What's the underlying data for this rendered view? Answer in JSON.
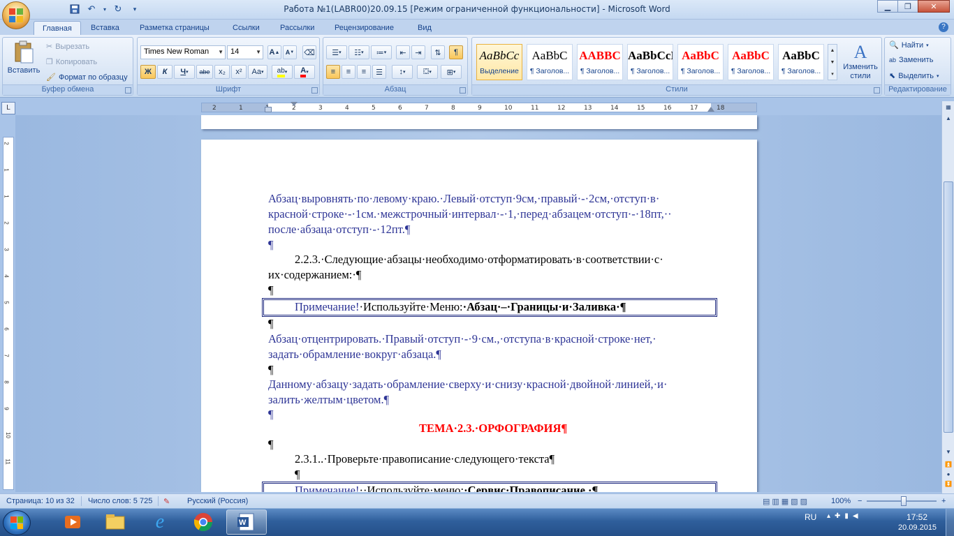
{
  "title": "Работа №1(LABR00)20.09.15 [Режим ограниченной функциональности] - Microsoft Word",
  "tabs": [
    "Главная",
    "Вставка",
    "Разметка страницы",
    "Ссылки",
    "Рассылки",
    "Рецензирование",
    "Вид"
  ],
  "ribbon": {
    "clipboard": {
      "paste": "Вставить",
      "cut": "Вырезать",
      "copy": "Копировать",
      "format_painter": "Формат по образцу",
      "label": "Буфер обмена"
    },
    "font": {
      "font_name": "Times New Roman",
      "font_size": "14",
      "label": "Шрифт",
      "bold": "Ж",
      "italic": "К",
      "underline": "Ч",
      "strike": "abe",
      "sub": "x₂",
      "sup": "x²",
      "case": "Aa",
      "grow": "A",
      "shrink": "A"
    },
    "paragraph": {
      "label": "Абзац"
    },
    "styles": {
      "label": "Стили",
      "items": [
        {
          "preview": "AaBbCc",
          "name": "Выделение",
          "color": "#000000"
        },
        {
          "preview": "AaBbC",
          "name": "¶ Заголов...",
          "color": "#000000"
        },
        {
          "preview": "AABBC",
          "name": "¶ Заголов...",
          "color": "#ff0000"
        },
        {
          "preview": "AaBbCcI",
          "name": "¶ Заголов...",
          "color": "#000000"
        },
        {
          "preview": "AaBbC",
          "name": "¶ Заголов...",
          "color": "#ff0000"
        },
        {
          "preview": "AaBbC",
          "name": "¶ Заголов...",
          "color": "#ff0000"
        },
        {
          "preview": "AaBbC",
          "name": "¶ Заголов...",
          "color": "#000000"
        }
      ],
      "change": "Изменить стили"
    },
    "editing": {
      "find": "Найти",
      "replace": "Заменить",
      "select": "Выделить",
      "label": "Редактирование"
    }
  },
  "ruler": {
    "ticks": [
      "2",
      "1",
      "1",
      "2",
      "3",
      "4",
      "5",
      "6",
      "7",
      "8",
      "9",
      "10",
      "11",
      "12",
      "13",
      "14",
      "15",
      "16",
      "17",
      "18"
    ]
  },
  "vruler": {
    "ticks": [
      "2",
      "1",
      "1",
      "2",
      "3",
      "4",
      "5",
      "6",
      "7",
      "8",
      "9",
      "10",
      "11"
    ]
  },
  "doc": {
    "p1": [
      "Абзац·выровнять·по·левому·краю.·Левый·отступ·9см,·правый·-·2см,·отступ·в·",
      "красной·строке·-·1см.·межстрочный·интервал·-·1,·перед·абзацем·отступ·-·18пт,··",
      "после·абзаца·отступ·-·12пт.¶"
    ],
    "pmark": "¶",
    "p2": [
      "2.2.3.·Следующие·абзацы·необходимо·отформатировать·в·соответствии·с·",
      "их·содержанием:·¶"
    ],
    "note1_a": "Примечание!",
    "note1_b": "·Используйте·Меню:",
    "note1_c": "·Абзац·–·Границы·и·Заливка·¶",
    "p3": [
      "Абзац·отцентрировать.·Правый·отступ·-·9·см.,·отступа·в·красной·строке·нет,·",
      "задать·обрамление·вокруг·абзаца.¶"
    ],
    "p4": [
      "Данному·абзацу·задать·обрамление·сверху·и·снизу·красной·двойной·линией,·и·",
      "залить·желтым·цветом.¶"
    ],
    "heading": "ТЕМА·2.3.·ОРФОГРАФИЯ¶",
    "p5": "2.3.1..·Проверьте·правописание·следующего·текста¶",
    "note2_a": "Примечание!",
    "note2_b": "··Используйте·меню:",
    "note2_c": "·Сервис·Правописание.·¶"
  },
  "status": {
    "page": "Страница: 10 из 32",
    "words": "Число слов: 5 725",
    "lang": "Русский (Россия)",
    "zoom": "100%",
    "zoom_minus": "−",
    "zoom_plus": "+"
  },
  "taskbar": {
    "lang": "RU",
    "time": "17:52",
    "date": "20.09.2015"
  },
  "colors": {
    "accent": "#15428b",
    "doc_blue": "#2e3596",
    "heading_red": "#ff0000"
  }
}
